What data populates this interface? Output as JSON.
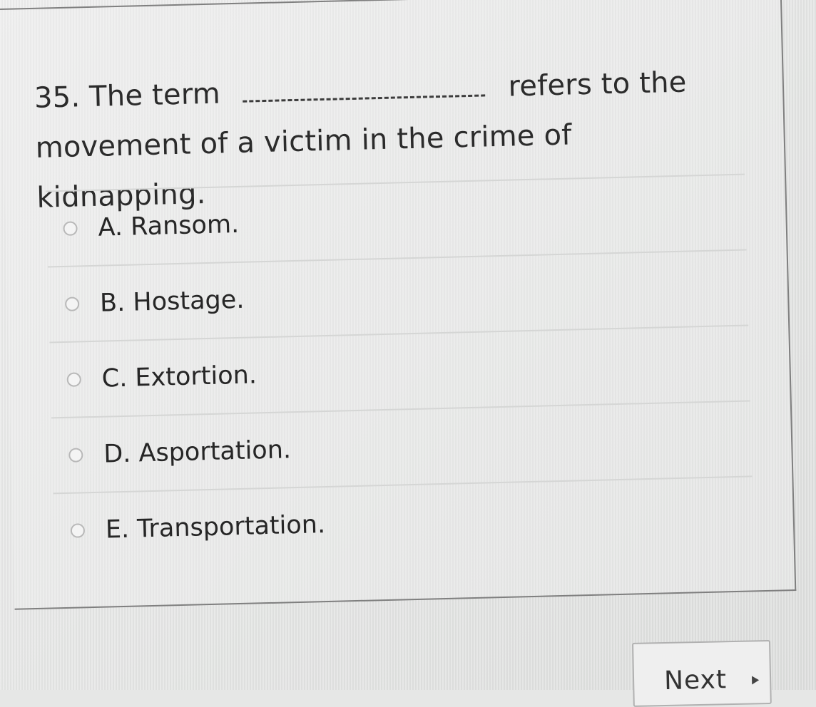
{
  "question": {
    "number": "35.",
    "text_before": "The term",
    "text_after": "refers to the movement of a victim in the crime of kidnapping."
  },
  "options": [
    {
      "label": "A. Ransom."
    },
    {
      "label": "B. Hostage."
    },
    {
      "label": "C. Extortion."
    },
    {
      "label": "D. Asportation."
    },
    {
      "label": "E. Transportation."
    }
  ],
  "navigation": {
    "next_label": "Next"
  }
}
